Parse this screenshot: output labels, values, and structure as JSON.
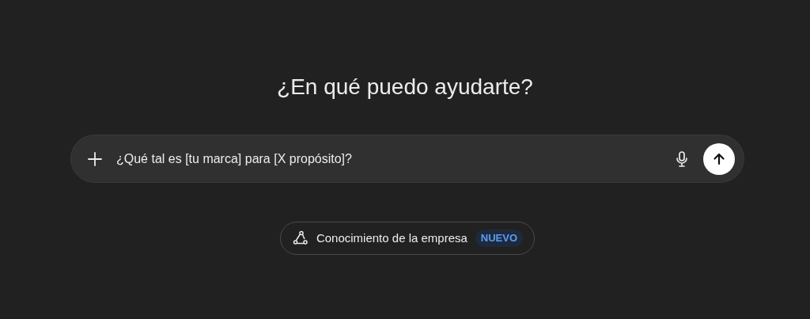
{
  "heading": "¿En qué puedo ayudarte?",
  "composer": {
    "value": "¿Qué tal es [tu marca] para [X propósito]?"
  },
  "feature_chip": {
    "label": "Conocimiento de la empresa",
    "badge": "NUEVO"
  }
}
